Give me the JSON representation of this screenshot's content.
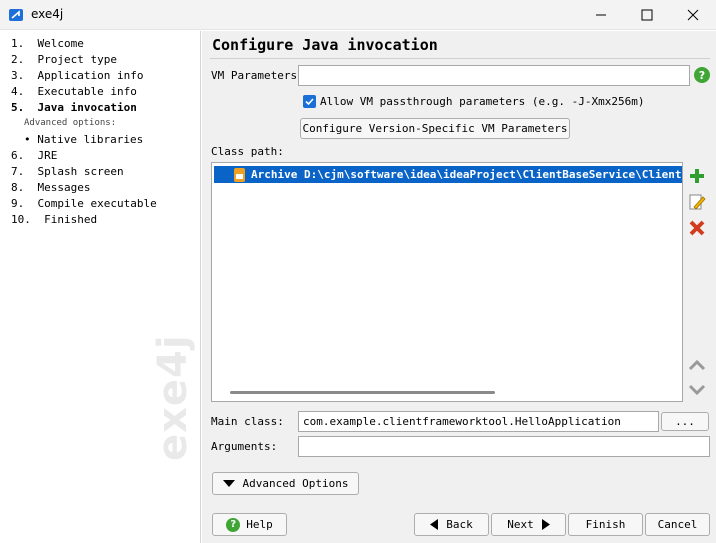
{
  "window": {
    "title": "exe4j"
  },
  "sidebar": {
    "steps": [
      {
        "label": "1.  Welcome"
      },
      {
        "label": "2.  Project type"
      },
      {
        "label": "3.  Application info"
      },
      {
        "label": "4.  Executable info"
      },
      {
        "label": "5.  Java invocation"
      },
      {
        "label": "6.  JRE"
      },
      {
        "label": "7.  Splash screen"
      },
      {
        "label": "8.  Messages"
      },
      {
        "label": "9.  Compile executable"
      },
      {
        "label": "10.  Finished"
      }
    ],
    "advanced_label": "Advanced options:",
    "advanced_items": [
      {
        "label": "• Native libraries"
      }
    ],
    "watermark": "exe4j"
  },
  "main": {
    "heading": "Configure Java invocation",
    "vm_params": {
      "label": "VM Parameters:",
      "value": ""
    },
    "passthrough": {
      "checked": true,
      "label": "Allow VM passthrough parameters (e.g. -J-Xmx256m)"
    },
    "version_button": "Configure Version-Specific VM Parameters",
    "classpath": {
      "label": "Class path:",
      "entries": [
        {
          "text": "Archive D:\\cjm\\software\\idea\\ideaProject\\ClientBaseService\\ClientFramework"
        }
      ]
    },
    "main_class": {
      "label": "Main class:",
      "value": "com.example.clientframeworktool.HelloApplication",
      "browse": "..."
    },
    "arguments": {
      "label": "Arguments:",
      "value": ""
    },
    "advanced_button": "Advanced Options"
  },
  "footer": {
    "help": "Help",
    "back": "Back",
    "next": "Next",
    "finish": "Finish",
    "cancel": "Cancel"
  },
  "colors": {
    "accent": "#0a64c8",
    "help": "#3fa535",
    "add": "#2e9e2e",
    "remove": "#d23c1e"
  }
}
